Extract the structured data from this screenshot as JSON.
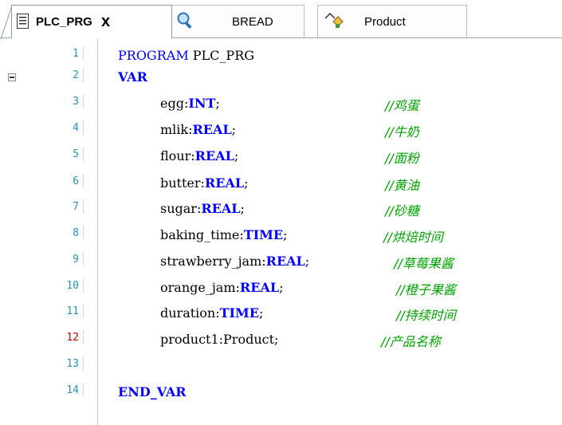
{
  "tabs": [
    {
      "label": "PLC_PRG",
      "close": "x",
      "active": true,
      "icon": "document-icon"
    },
    {
      "label": "BREAD",
      "active": false,
      "icon": "magnifier-icon"
    },
    {
      "label": "Product",
      "active": false,
      "icon": "struct-icon"
    }
  ],
  "line_numbers": [
    "1",
    "2",
    "3",
    "4",
    "5",
    "6",
    "7",
    "8",
    "9",
    "10",
    "11",
    "12",
    "13",
    "14"
  ],
  "code": {
    "l1_kw": "PROGRAM",
    "l1_name": " PLC_PRG",
    "l2_kw": "VAR",
    "l14_kw": "END_VAR",
    "vars": [
      {
        "name": "egg:",
        "type": "INT",
        "end": ";",
        "comment": "//鸡蛋"
      },
      {
        "name": "mlik:",
        "type": "REAL",
        "end": ";",
        "comment": "//牛奶"
      },
      {
        "name": "flour:",
        "type": "REAL",
        "end": ";",
        "comment": "//面粉"
      },
      {
        "name": "butter:",
        "type": "REAL",
        "end": ";",
        "comment": "//黄油"
      },
      {
        "name": "sugar:",
        "type": "REAL",
        "end": ";",
        "comment": "//砂糖"
      },
      {
        "name": "baking_time:",
        "type": "TIME",
        "end": ";",
        "comment": "//烘焙时间"
      },
      {
        "name": "strawberry_jam:",
        "type": "REAL",
        "end": ";",
        "comment": "//草莓果酱"
      },
      {
        "name": "orange_jam:",
        "type": "REAL",
        "end": ";",
        "comment": "//橙子果酱"
      },
      {
        "name": "duration:",
        "type": "TIME",
        "end": ";",
        "comment": "//持续时间"
      },
      {
        "name": "product1:Product;",
        "type": "",
        "end": "",
        "comment": "//产品名称"
      }
    ]
  },
  "colors": {
    "keyword": "#0000ff",
    "comment": "#00a000",
    "line_number": "#2b91af",
    "modified_line": "#c00000"
  }
}
